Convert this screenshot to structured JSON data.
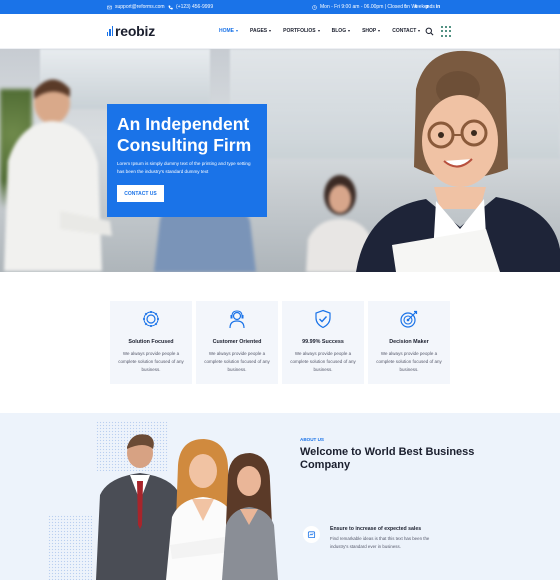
{
  "topbar": {
    "email": "support@reforms.com",
    "phone": "(+123) 456-9999",
    "hours": "Mon - Fri 9:00 am - 06.00pm | Closed on Weekends",
    "social": [
      "f",
      "t",
      "p",
      "in"
    ]
  },
  "header": {
    "logo": "reobiz",
    "nav": [
      {
        "label": "HOME",
        "active": true
      },
      {
        "label": "PAGES",
        "active": false
      },
      {
        "label": "PORTFOLIOS",
        "active": false
      },
      {
        "label": "BLOG",
        "active": false
      },
      {
        "label": "SHOP",
        "active": false
      },
      {
        "label": "CONTACT",
        "active": false
      }
    ],
    "icons": [
      "search-icon",
      "apps-grid-icon"
    ]
  },
  "hero": {
    "title": "An Independent Consulting Firm",
    "text": "Lorem Ipsum is simply dummy text of the printing and type setting has been the industry's standard dummy text",
    "button": "CONTACT US"
  },
  "features": [
    {
      "icon": "gear-icon",
      "title": "Solution Focused",
      "text": "We always provide people a complete solution focused of any business."
    },
    {
      "icon": "support-agent-icon",
      "title": "Customer Oriented",
      "text": "We always provide people a complete solution focused of any business."
    },
    {
      "icon": "shield-check-icon",
      "title": "99.99% Success",
      "text": "We always provide people a complete solution focused of any business."
    },
    {
      "icon": "target-icon",
      "title": "Decision Maker",
      "text": "We always provide people a complete solution focused of any business."
    }
  ],
  "about": {
    "eyebrow": "ABOUT US",
    "title": "Welcome to World Best Business Company",
    "feature_title": "Ensure to increase of expected sales",
    "feature_text": "Find remarkable ideas is that this text has been the industry's standard ever in business."
  },
  "colors": {
    "accent": "#1a73e8",
    "dark": "#1b1f2e",
    "card_bg": "#f3f6fb",
    "about_bg": "#edf3fb"
  }
}
